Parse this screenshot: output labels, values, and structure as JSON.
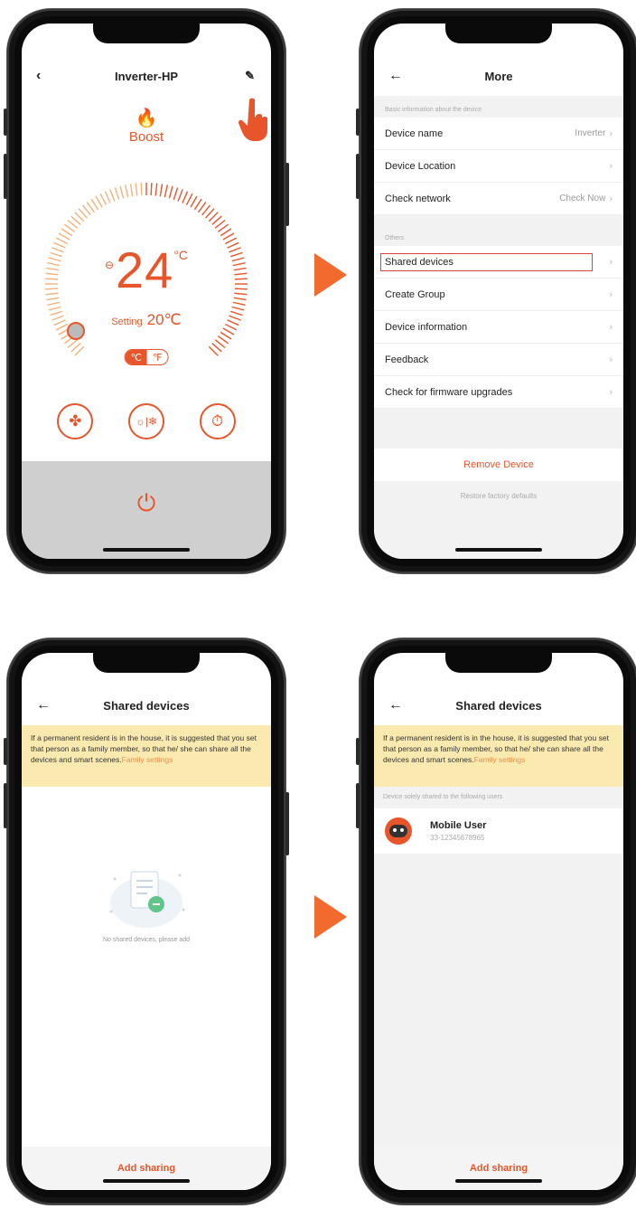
{
  "colors": {
    "accent": "#e8552b",
    "arrow": "#f26a2e",
    "banner": "#fbeaaf",
    "highlight_border": "#d9443a"
  },
  "screen1": {
    "title": "Inverter-HP",
    "back_icon": "chevron-left-icon",
    "edit_icon": "edit-pencil-icon",
    "mode_label": "Boost",
    "current_temp": "24",
    "current_unit": "°C",
    "minus_symbol": "⊖",
    "setting_label": "Setting",
    "setting_value": "20℃",
    "unit_c": "℃",
    "unit_f": "℉",
    "controls": [
      "fan-icon",
      "mode-sun-snow-icon",
      "timer-icon"
    ],
    "power_icon": "power-icon"
  },
  "screen2": {
    "title": "More",
    "section_basic": "Basic information about the device",
    "rows_basic": [
      {
        "label": "Device name",
        "value": "Inverter"
      },
      {
        "label": "Device Location",
        "value": ""
      },
      {
        "label": "Check network",
        "value": "Check Now"
      }
    ],
    "section_others": "Others",
    "rows_others": [
      {
        "label": "Shared devices"
      },
      {
        "label": "Create Group"
      },
      {
        "label": "Device information"
      },
      {
        "label": "Feedback"
      },
      {
        "label": "Check for firmware upgrades"
      }
    ],
    "remove_device": "Remove Device",
    "restore_defaults": "Restore factory defaults"
  },
  "screen3": {
    "title": "Shared devices",
    "banner_text": "If a permanent resident is in the house, it is suggested that you set that person as a family member, so that he/ she can share all the devices and smart scenes.",
    "banner_link": "Family settings",
    "empty_text": "No shared devices, please add",
    "add_sharing": "Add sharing"
  },
  "screen4": {
    "title": "Shared devices",
    "banner_text": "If a permanent resident is in the house, it is suggested that you set that person as a family member, so that he/ she can share all the devices and smart scenes.",
    "banner_link": "Family settings",
    "shared_header": "Device solely shared to the following users",
    "user_name": "Mobile User",
    "user_id": "33-12345678965",
    "add_sharing": "Add sharing"
  }
}
